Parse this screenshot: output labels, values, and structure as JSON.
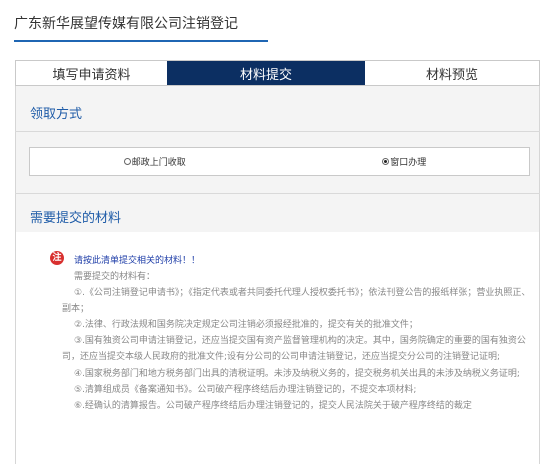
{
  "page": {
    "title": "广东新华展望传媒有限公司注销登记"
  },
  "tabs": [
    {
      "label": "填写申请资料",
      "active": false
    },
    {
      "label": "材料提交",
      "active": true
    },
    {
      "label": "材料预览",
      "active": false
    }
  ],
  "pickup": {
    "title": "领取方式",
    "options": [
      {
        "label": "邮政上门收取",
        "selected": false
      },
      {
        "label": "窗口办理",
        "selected": true
      }
    ]
  },
  "materials": {
    "title": "需要提交的材料",
    "notice_icon": "注",
    "notice": "请按此清单提交相关的材料！！",
    "intro": "需要提交的材料有：",
    "items": [
      "①.《公司注销登记申请书》；《指定代表或者共同委托代理人授权委托书》；依法刊登公告的报纸样张；营业执照正、副本；",
      "②.法律、行政法规和国务院决定规定公司注销必须报经批准的，提交有关的批准文件；",
      "③.国有独资公司申请注销登记，还应当提交国有资产监督管理机构的决定。其中，国务院确定的重要的国有独资公司，还应当提交本级人民政府的批准文件;设有分公司的公司申请注销登记，还应当提交分公司的注销登记证明;",
      "④.国家税务部门和地方税务部门出具的清税证明。未涉及纳税义务的，提交税务机关出具的未涉及纳税义务证明;",
      "⑤.清算组成员《备案通知书》。公司破产程序终结后办理注销登记的，不提交本项材料;",
      "⑥.经确认的清算报告。公司破产程序终结后办理注销登记的，提交人民法院关于破产程序终结的裁定"
    ]
  },
  "colors": {
    "accent": "#1f66b3",
    "tab_active_bg": "#0c2f62",
    "section_title": "#1f5ca8",
    "notice_icon_bg": "#d8302f",
    "notice_text": "#1f3ea8"
  }
}
